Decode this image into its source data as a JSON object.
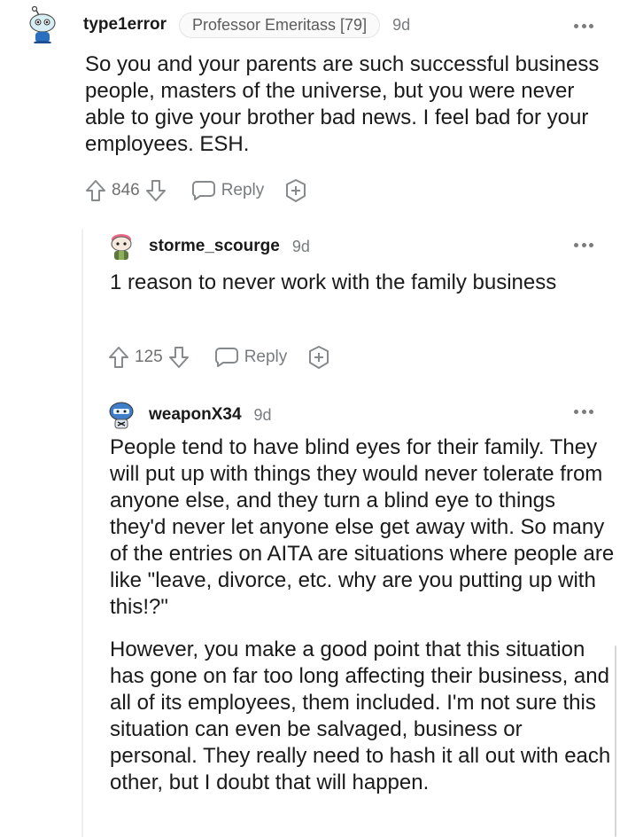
{
  "comments": [
    {
      "username": "type1error",
      "flair": "Professor Emeritass [79]",
      "age": "9d",
      "paragraphs": [
        "So you and your parents are such successful business people, masters of the universe, but you were never able to give your brother bad news. I feel bad for your employees. ESH."
      ],
      "score": "846",
      "reply_label": "Reply",
      "avatar_icon": "snoo-robot-avatar-icon"
    },
    {
      "username": "storme_scourge",
      "age": "9d",
      "paragraphs": [
        "1 reason to never work with the family business"
      ],
      "score": "125",
      "reply_label": "Reply",
      "avatar_icon": "snoo-pink-hair-avatar-icon"
    },
    {
      "username": "weaponX34",
      "age": "9d",
      "paragraphs": [
        "People tend to have blind eyes for their family. They will put up with things they would never tolerate from anyone else, and they turn a blind eye to things they'd never let anyone else get away with. So many of the entries on AITA are situations where people are like \"leave, divorce, etc. why are you putting up with this!?\"",
        "However, you make a good point that this situation has gone on far too long affecting their business, and all of its employees, them included. I'm not sure this situation can even be salvaged, business or personal. They really need to hash it all out with each other, but I doubt that will happen."
      ],
      "avatar_icon": "snoo-helmet-avatar-icon"
    }
  ],
  "colors": {
    "text": "#1a1a1b",
    "meta": "#787c7e",
    "thread_line": "#edeff1"
  }
}
